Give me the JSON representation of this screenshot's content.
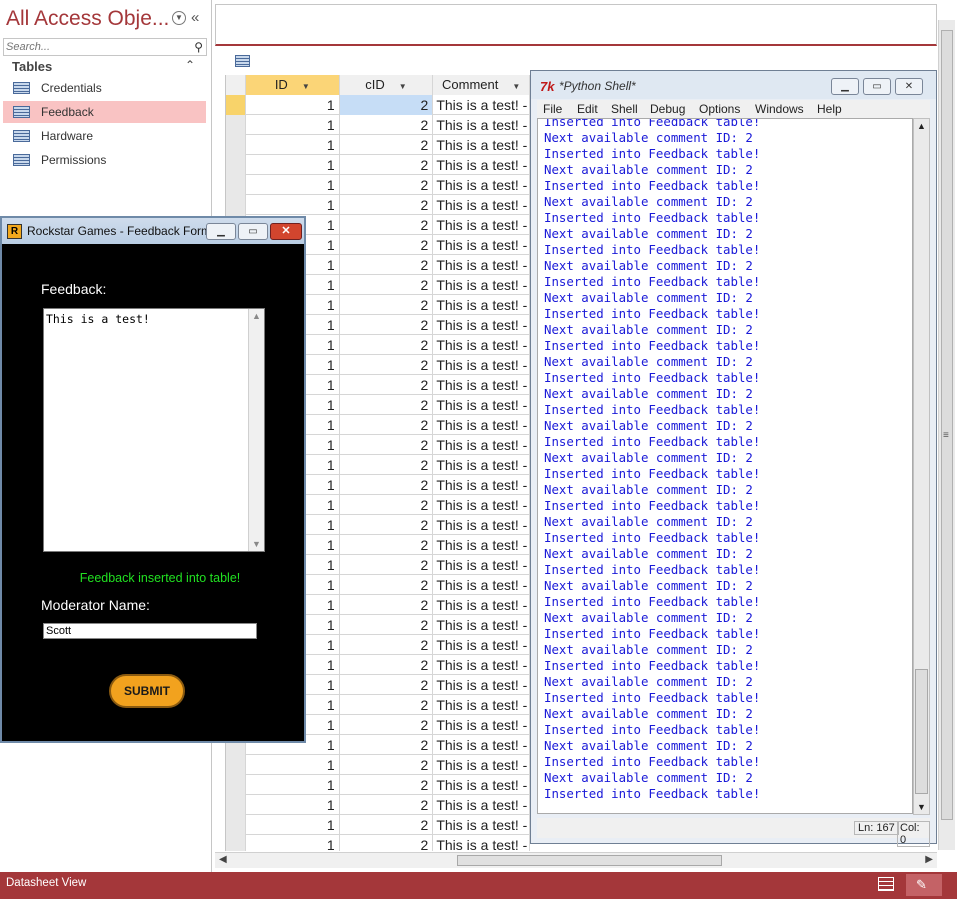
{
  "nav": {
    "title": "All Access Obje...",
    "search_placeholder": "Search...",
    "group": "Tables",
    "items": [
      {
        "label": "Credentials"
      },
      {
        "label": "Feedback"
      },
      {
        "label": "Hardware"
      },
      {
        "label": "Permissions"
      }
    ]
  },
  "datasheet": {
    "columns": [
      "ID",
      "cID",
      "Comment"
    ],
    "rows": [
      [
        "1",
        "2",
        "This is a test! -"
      ],
      [
        "1",
        "2",
        "This is a test! -"
      ],
      [
        "1",
        "2",
        "This is a test! -"
      ],
      [
        "1",
        "2",
        "This is a test! -"
      ],
      [
        "1",
        "2",
        "This is a test! -"
      ],
      [
        "1",
        "2",
        "This is a test! -"
      ],
      [
        "1",
        "2",
        "This is a test! -"
      ],
      [
        "1",
        "2",
        "This is a test! -"
      ],
      [
        "1",
        "2",
        "This is a test! -"
      ],
      [
        "1",
        "2",
        "This is a test! -"
      ],
      [
        "1",
        "2",
        "This is a test! -"
      ],
      [
        "1",
        "2",
        "This is a test! -"
      ],
      [
        "1",
        "2",
        "This is a test! -"
      ],
      [
        "1",
        "2",
        "This is a test! -"
      ],
      [
        "1",
        "2",
        "This is a test! -"
      ],
      [
        "1",
        "2",
        "This is a test! -"
      ],
      [
        "1",
        "2",
        "This is a test! -"
      ],
      [
        "1",
        "2",
        "This is a test! -"
      ],
      [
        "1",
        "2",
        "This is a test! -"
      ],
      [
        "1",
        "2",
        "This is a test! -"
      ],
      [
        "1",
        "2",
        "This is a test! -"
      ],
      [
        "1",
        "2",
        "This is a test! -"
      ],
      [
        "1",
        "2",
        "This is a test! -"
      ],
      [
        "1",
        "2",
        "This is a test! -"
      ],
      [
        "1",
        "2",
        "This is a test! -"
      ],
      [
        "1",
        "2",
        "This is a test! -"
      ],
      [
        "1",
        "2",
        "This is a test! -"
      ],
      [
        "1",
        "2",
        "This is a test! -"
      ],
      [
        "1",
        "2",
        "This is a test! -"
      ],
      [
        "1",
        "2",
        "This is a test! -"
      ],
      [
        "1",
        "2",
        "This is a test! -"
      ],
      [
        "1",
        "2",
        "This is a test! -"
      ],
      [
        "1",
        "2",
        "This is a test! -"
      ],
      [
        "1",
        "2",
        "This is a test! -"
      ],
      [
        "1",
        "2",
        "This is a test! -"
      ],
      [
        "1",
        "2",
        "This is a test! -"
      ],
      [
        "1",
        "2",
        "This is a test! -"
      ],
      [
        "1",
        "2",
        "This is a test! -"
      ]
    ]
  },
  "python_shell": {
    "title": "*Python Shell*",
    "logo": "7k",
    "menu": [
      "File",
      "Edit",
      "Shell",
      "Debug",
      "Options",
      "Windows",
      "Help"
    ],
    "lines": [
      "Inserted into Feedback table!",
      "Next available comment ID: 2",
      "Inserted into Feedback table!",
      "Next available comment ID: 2",
      "Inserted into Feedback table!",
      "Next available comment ID: 2",
      "Inserted into Feedback table!",
      "Next available comment ID: 2",
      "Inserted into Feedback table!",
      "Next available comment ID: 2",
      "Inserted into Feedback table!",
      "Next available comment ID: 2",
      "Inserted into Feedback table!",
      "Next available comment ID: 2",
      "Inserted into Feedback table!",
      "Next available comment ID: 2",
      "Inserted into Feedback table!",
      "Next available comment ID: 2",
      "Inserted into Feedback table!",
      "Next available comment ID: 2",
      "Inserted into Feedback table!",
      "Next available comment ID: 2",
      "Inserted into Feedback table!",
      "Next available comment ID: 2",
      "Inserted into Feedback table!",
      "Next available comment ID: 2",
      "Inserted into Feedback table!",
      "Next available comment ID: 2",
      "Inserted into Feedback table!",
      "Next available comment ID: 2",
      "Inserted into Feedback table!",
      "Next available comment ID: 2",
      "Inserted into Feedback table!",
      "Next available comment ID: 2",
      "Inserted into Feedback table!",
      "Next available comment ID: 2",
      "Inserted into Feedback table!",
      "Next available comment ID: 2",
      "Inserted into Feedback table!",
      "Next available comment ID: 2",
      "Inserted into Feedback table!",
      "Next available comment ID: 2",
      "Inserted into Feedback table!"
    ],
    "status_ln": "Ln: 167",
    "status_col": "Col: 0"
  },
  "feedback_form": {
    "logo": "R",
    "title": "Rockstar Games - Feedback Form",
    "feedback_label": "Feedback:",
    "feedback_value": "This is a test!",
    "status_message": "Feedback inserted into table!",
    "moderator_label": "Moderator Name:",
    "moderator_value": "Scott",
    "submit_label": "SUBMIT"
  },
  "statusbar": {
    "view": "Datasheet View"
  },
  "colors": {
    "access_accent": "#a4373a",
    "selected_nav": "#f9c3c3",
    "shell_text": "#1a1ad8",
    "form_status": "#21e021",
    "submit_button": "#f2a21e"
  }
}
